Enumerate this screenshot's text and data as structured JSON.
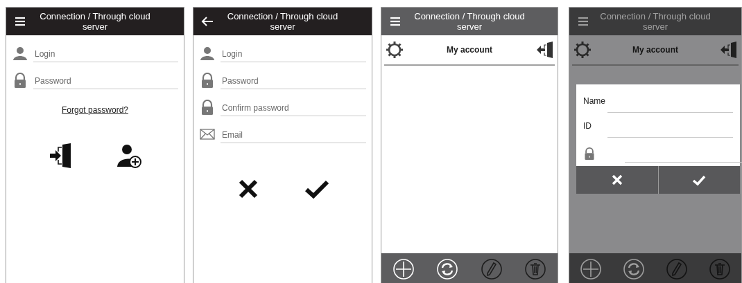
{
  "screens": [
    {
      "kind": "login",
      "header": {
        "title": "Connection / Through cloud server",
        "kind": "menu"
      },
      "fields": [
        {
          "kind": "user",
          "placeholder": "Login"
        },
        {
          "kind": "lock",
          "placeholder": "Password"
        }
      ],
      "link": "Forgot password?",
      "actions": [
        {
          "kind": "sign-in"
        },
        {
          "kind": "add-user"
        }
      ]
    },
    {
      "kind": "register",
      "header": {
        "title": "Connection / Through cloud server",
        "kind": "back"
      },
      "fields": [
        {
          "kind": "user",
          "placeholder": "Login"
        },
        {
          "kind": "lock",
          "placeholder": "Password"
        },
        {
          "kind": "lock",
          "placeholder": "Confirm password"
        },
        {
          "kind": "email",
          "placeholder": "Email"
        }
      ],
      "actions": [
        {
          "kind": "cancel"
        },
        {
          "kind": "confirm"
        }
      ]
    },
    {
      "kind": "account",
      "header": {
        "title": "Connection / Through cloud server",
        "kind": "menu"
      },
      "section_title": "My account",
      "toolbar": [
        {
          "kind": "add",
          "disabled": false
        },
        {
          "kind": "refresh",
          "disabled": false
        },
        {
          "kind": "edit",
          "disabled": true
        },
        {
          "kind": "delete",
          "disabled": true
        }
      ]
    },
    {
      "kind": "account",
      "header": {
        "title": "Connection / Through cloud server",
        "kind": "menu"
      },
      "section_title": "My account",
      "toolbar": [
        {
          "kind": "add",
          "disabled": false
        },
        {
          "kind": "refresh",
          "disabled": false
        },
        {
          "kind": "edit",
          "disabled": true
        },
        {
          "kind": "delete",
          "disabled": true
        }
      ],
      "dialog": {
        "fields": [
          {
            "kind": "text",
            "label": "Name"
          },
          {
            "kind": "text",
            "label": "ID"
          },
          {
            "kind": "lock"
          }
        ],
        "buttons": [
          {
            "kind": "cancel"
          },
          {
            "kind": "confirm"
          }
        ]
      }
    }
  ]
}
